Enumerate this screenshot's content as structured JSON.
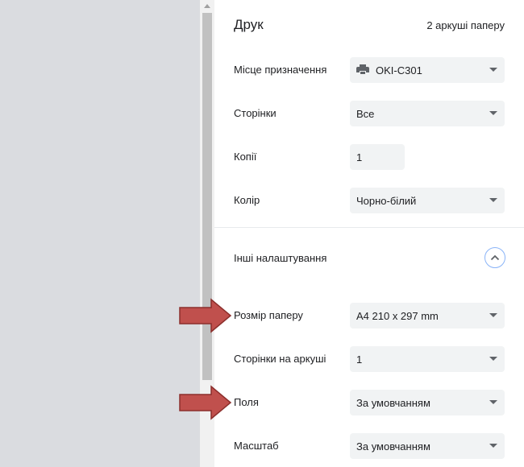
{
  "header": {
    "title": "Друк",
    "sheet_count": "2 аркуші паперу"
  },
  "settings": {
    "destination": {
      "label": "Місце призначення",
      "value": "OKI-C301",
      "icon": "printer-icon"
    },
    "pages": {
      "label": "Сторінки",
      "value": "Все"
    },
    "copies": {
      "label": "Копії",
      "value": "1"
    },
    "color": {
      "label": "Колір",
      "value": "Чорно-білий"
    }
  },
  "more_settings": {
    "label": "Інші налаштування",
    "icon": "chevron-up-icon",
    "paper_size": {
      "label": "Розмір паперу",
      "value": "A4 210 x 297 mm"
    },
    "pages_per_sheet": {
      "label": "Сторінки на аркуші",
      "value": "1"
    },
    "margins": {
      "label": "Поля",
      "value": "За умовчанням"
    },
    "scale": {
      "label": "Масштаб",
      "value": "За умовчанням"
    }
  },
  "colors": {
    "accent": "#8ab4f8",
    "annotation_arrow": "#c0504d"
  }
}
